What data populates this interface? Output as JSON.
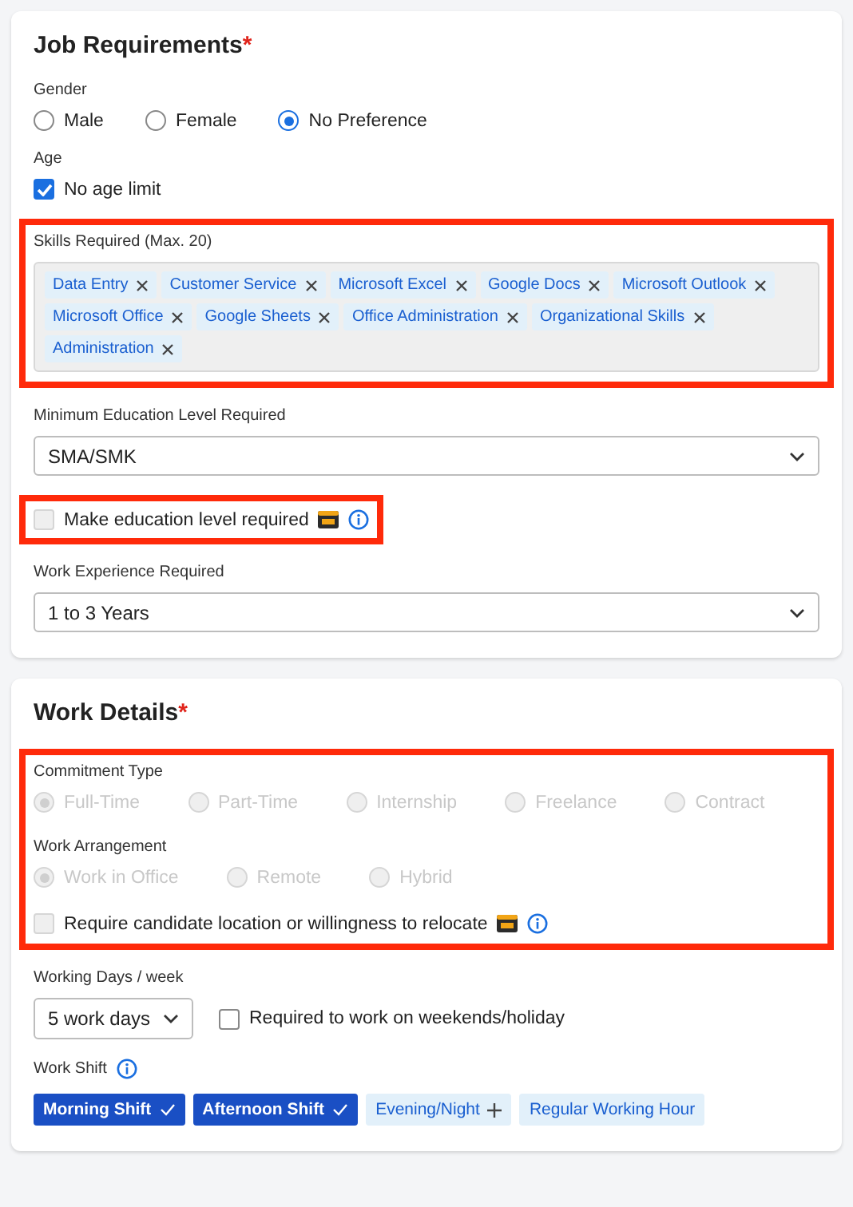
{
  "sections": [
    {
      "title": "Job Requirements",
      "required_mark": "*",
      "fields": [
        {
          "kind": "radio_group",
          "label": "Gender",
          "options": [
            {
              "label": "Male",
              "selected": false
            },
            {
              "label": "Female",
              "selected": false
            },
            {
              "label": "No Preference",
              "selected": true
            }
          ]
        },
        {
          "kind": "checkbox",
          "label": "Age",
          "text": "No age limit",
          "checked": true
        },
        {
          "kind": "frame",
          "fields": [
            {
              "kind": "tags",
              "label": "Skills Required (Max. 20)",
              "tags": [
                "Data Entry",
                "Customer Service",
                "Microsoft Excel",
                "Google Docs",
                "Microsoft Outlook",
                "Microsoft Office",
                "Google Sheets",
                "Office Administration",
                "Organizational Skills",
                "Administration"
              ]
            }
          ]
        },
        {
          "kind": "select",
          "label": "Minimum Education Level Required",
          "value": "SMA/SMK"
        },
        {
          "kind": "frame",
          "fit": true,
          "fields": [
            {
              "kind": "checkbox",
              "text": "Make education level required",
              "checked": false,
              "disabled": true,
              "vip": true,
              "info": true
            }
          ]
        },
        {
          "kind": "select",
          "label": "Work Experience Required",
          "value": "1 to 3 Years"
        }
      ]
    },
    {
      "title": "Work Details",
      "required_mark": "*",
      "fields": [
        {
          "kind": "frame",
          "fields": [
            {
              "kind": "radio_group",
              "label": "Commitment Type",
              "disabled": true,
              "options": [
                {
                  "label": "Full-Time",
                  "selected": true
                },
                {
                  "label": "Part-Time",
                  "selected": false
                },
                {
                  "label": "Internship",
                  "selected": false
                },
                {
                  "label": "Freelance",
                  "selected": false
                },
                {
                  "label": "Contract",
                  "selected": false
                }
              ]
            },
            {
              "kind": "radio_group",
              "label": "Work Arrangement",
              "disabled": true,
              "options": [
                {
                  "label": "Work in Office",
                  "selected": true
                },
                {
                  "label": "Remote",
                  "selected": false
                },
                {
                  "label": "Hybrid",
                  "selected": false
                }
              ]
            },
            {
              "kind": "checkbox",
              "text": "Require candidate location or willingness to relocate",
              "checked": false,
              "disabled": true,
              "vip": true,
              "info": true
            }
          ]
        },
        {
          "kind": "select_row",
          "label": "Working Days / week",
          "value": "5 work days",
          "checkbox": {
            "text": "Required to work on weekends/holiday",
            "checked": false
          }
        },
        {
          "kind": "chips",
          "label": "Work Shift",
          "info": true,
          "chips": [
            {
              "label": "Morning Shift",
              "selected": true
            },
            {
              "label": "Afternoon Shift",
              "selected": true
            },
            {
              "label": "Evening/Night",
              "selected": false,
              "addable": true
            },
            {
              "label": "Regular Working Hour",
              "selected": false,
              "addable": false
            }
          ]
        }
      ]
    }
  ]
}
